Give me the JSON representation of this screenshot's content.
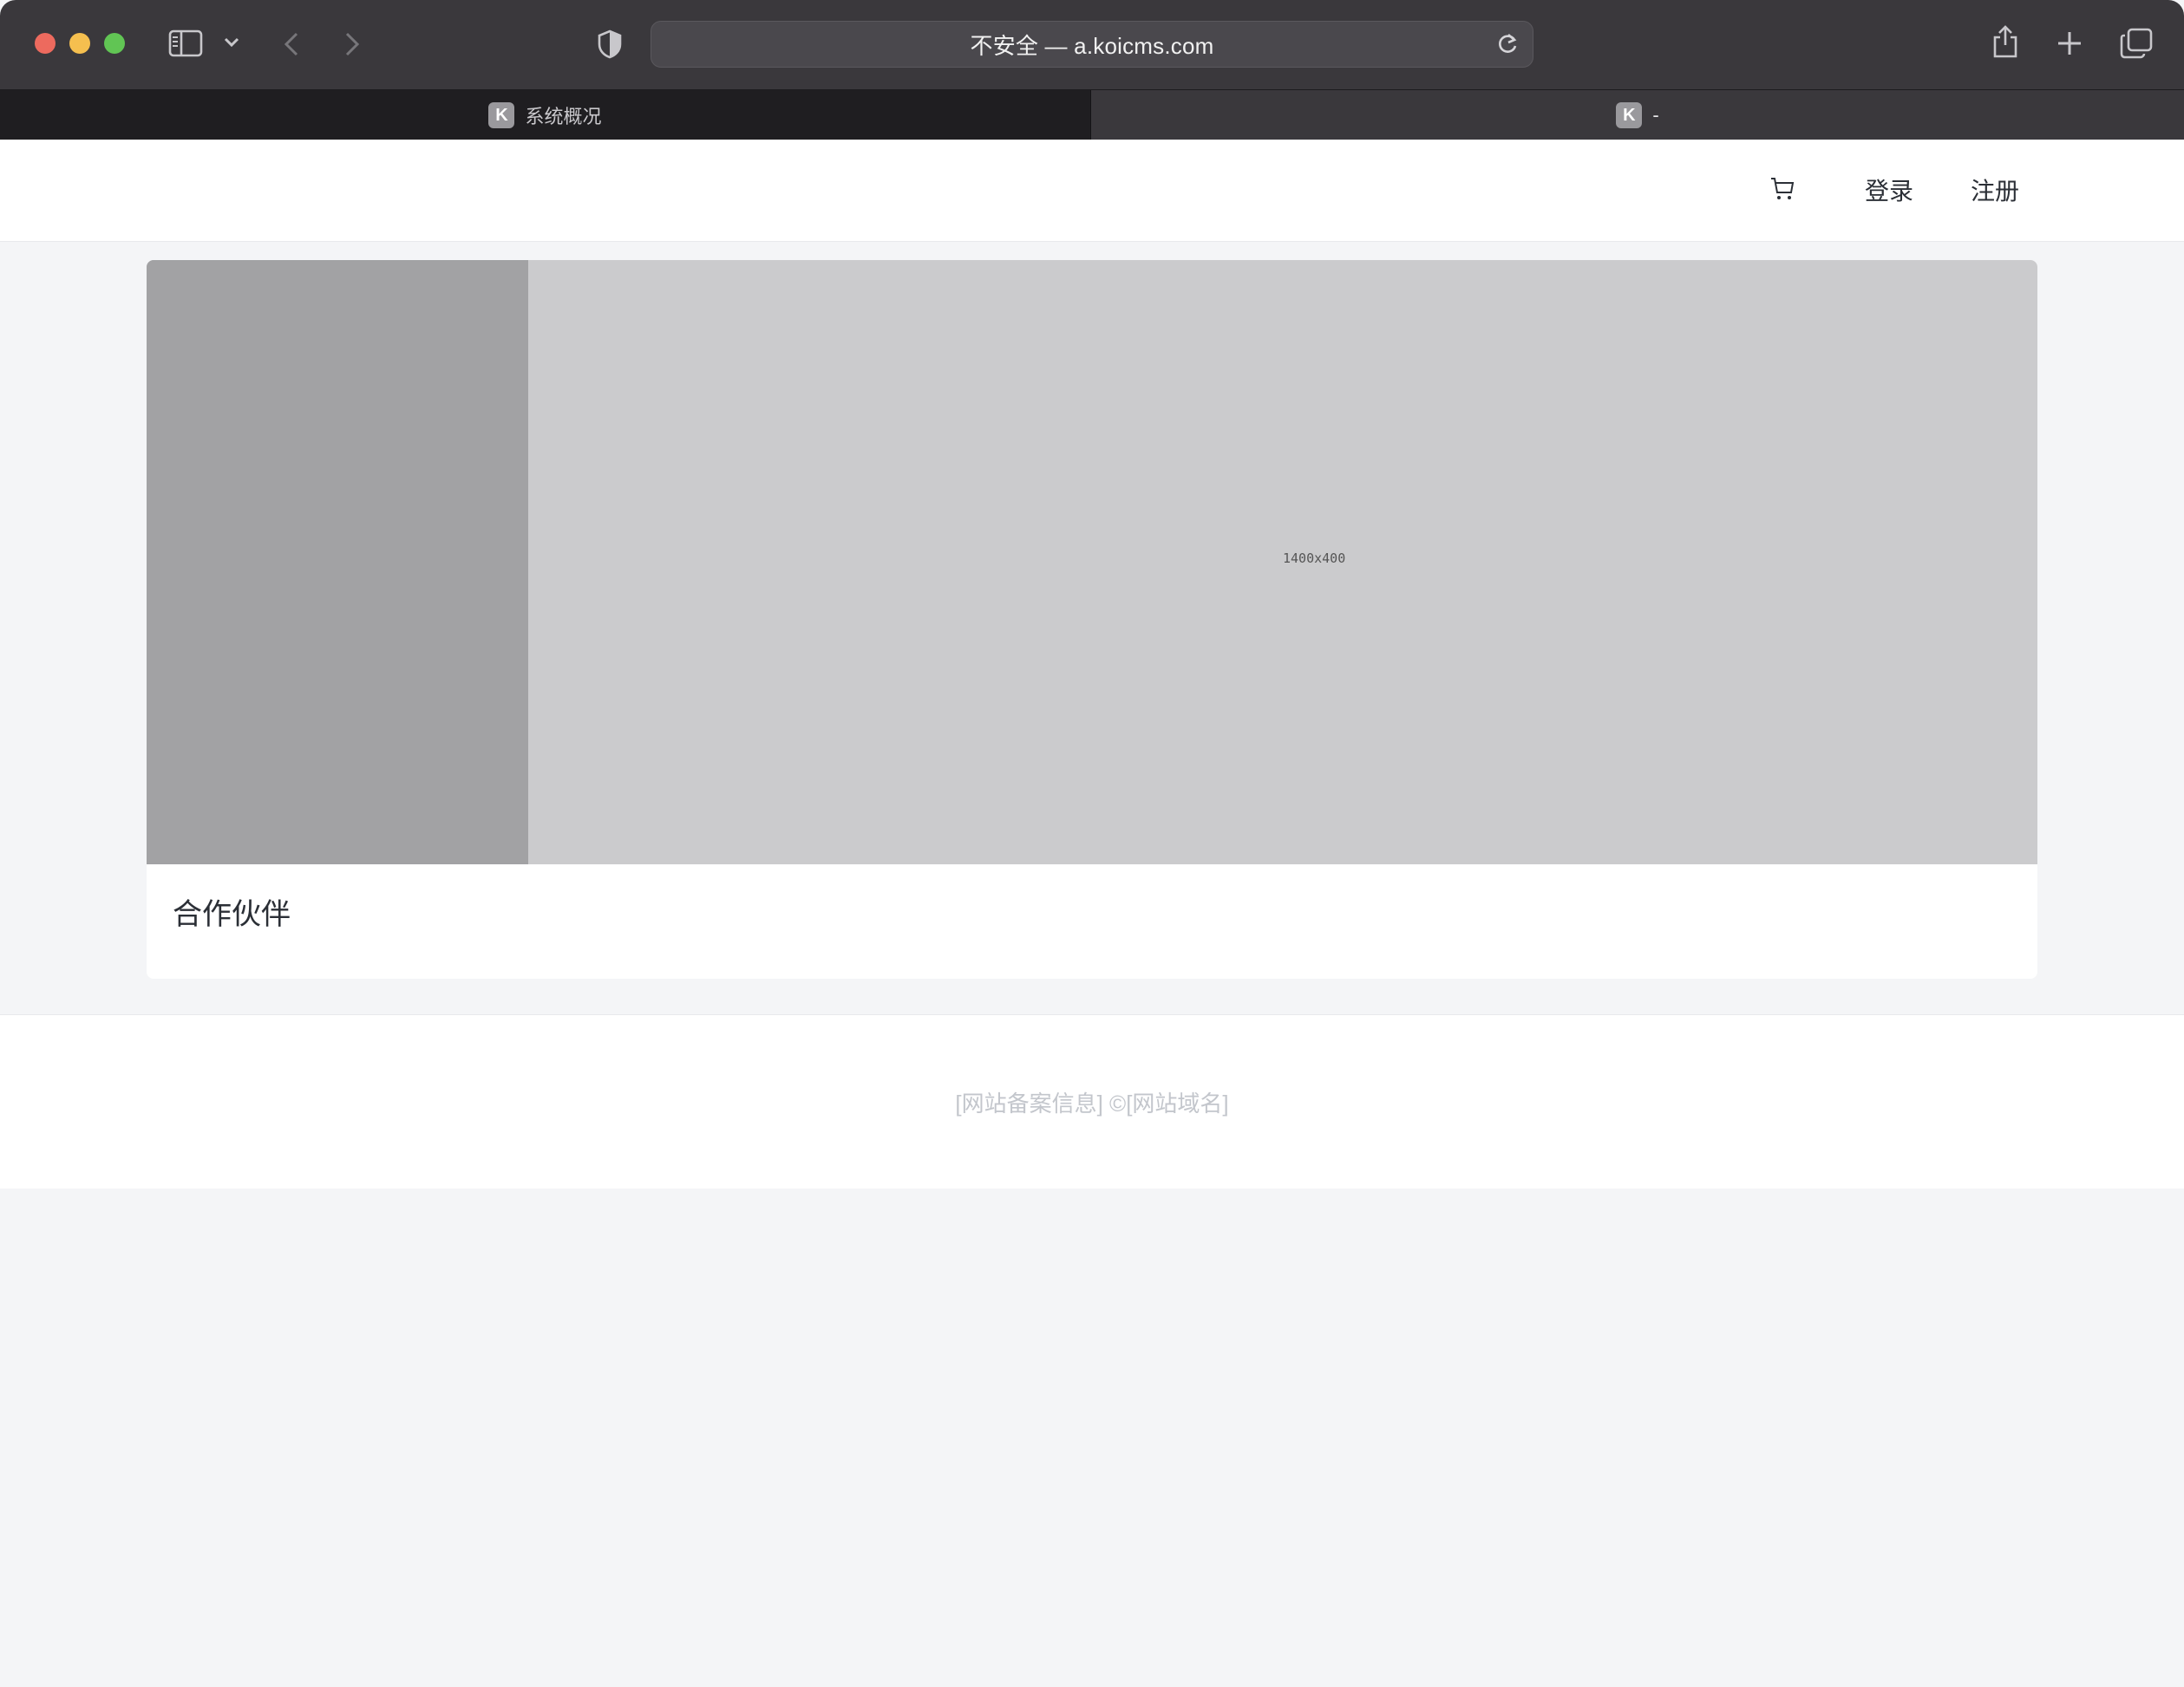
{
  "browser": {
    "address": "不安全 — a.koicms.com",
    "tabs": [
      {
        "favicon": "K",
        "label": "系统概况"
      },
      {
        "favicon": "K",
        "label": "-"
      }
    ],
    "icons": [
      "sidebar-icon",
      "chevron-down-icon",
      "back-icon",
      "forward-icon",
      "shield-icon",
      "reload-icon",
      "share-icon",
      "new-tab-icon",
      "tabs-overview-icon"
    ]
  },
  "header": {
    "cart_icon": "cart-icon",
    "login": "登录",
    "register": "注册"
  },
  "banner": {
    "placeholder": "1400x400"
  },
  "section": {
    "partners_title": "合作伙伴"
  },
  "footer": {
    "text": "[网站备案信息] ©[网站域名]"
  },
  "colors": {
    "chrome_bg": "#3a383c",
    "page_bg": "#f4f5f7",
    "banner_gray": "#cbcbcd",
    "banner_side": "#a2a2a4"
  }
}
